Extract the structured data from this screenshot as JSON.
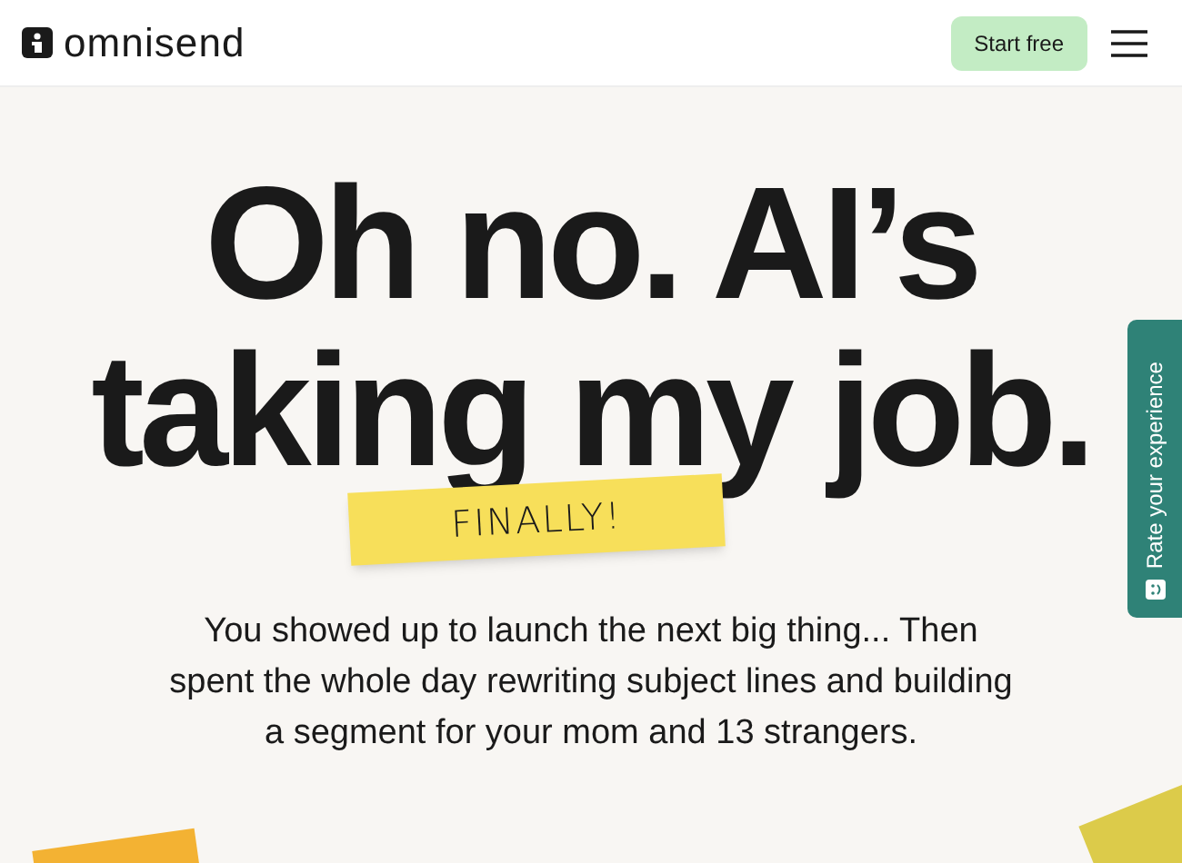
{
  "header": {
    "logo_text": "omnisend",
    "cta": "Start free"
  },
  "hero": {
    "headline_lines": [
      "Oh no. AI’s",
      "taking my job."
    ],
    "note": "FINALLY!",
    "subtitle_lines": [
      "You showed up to launch the next big thing... Then",
      "spent the whole day rewriting subject lines and building",
      "a segment for your mom and 13 strangers."
    ]
  },
  "feedback_tab": {
    "label": "Rate your experience"
  }
}
